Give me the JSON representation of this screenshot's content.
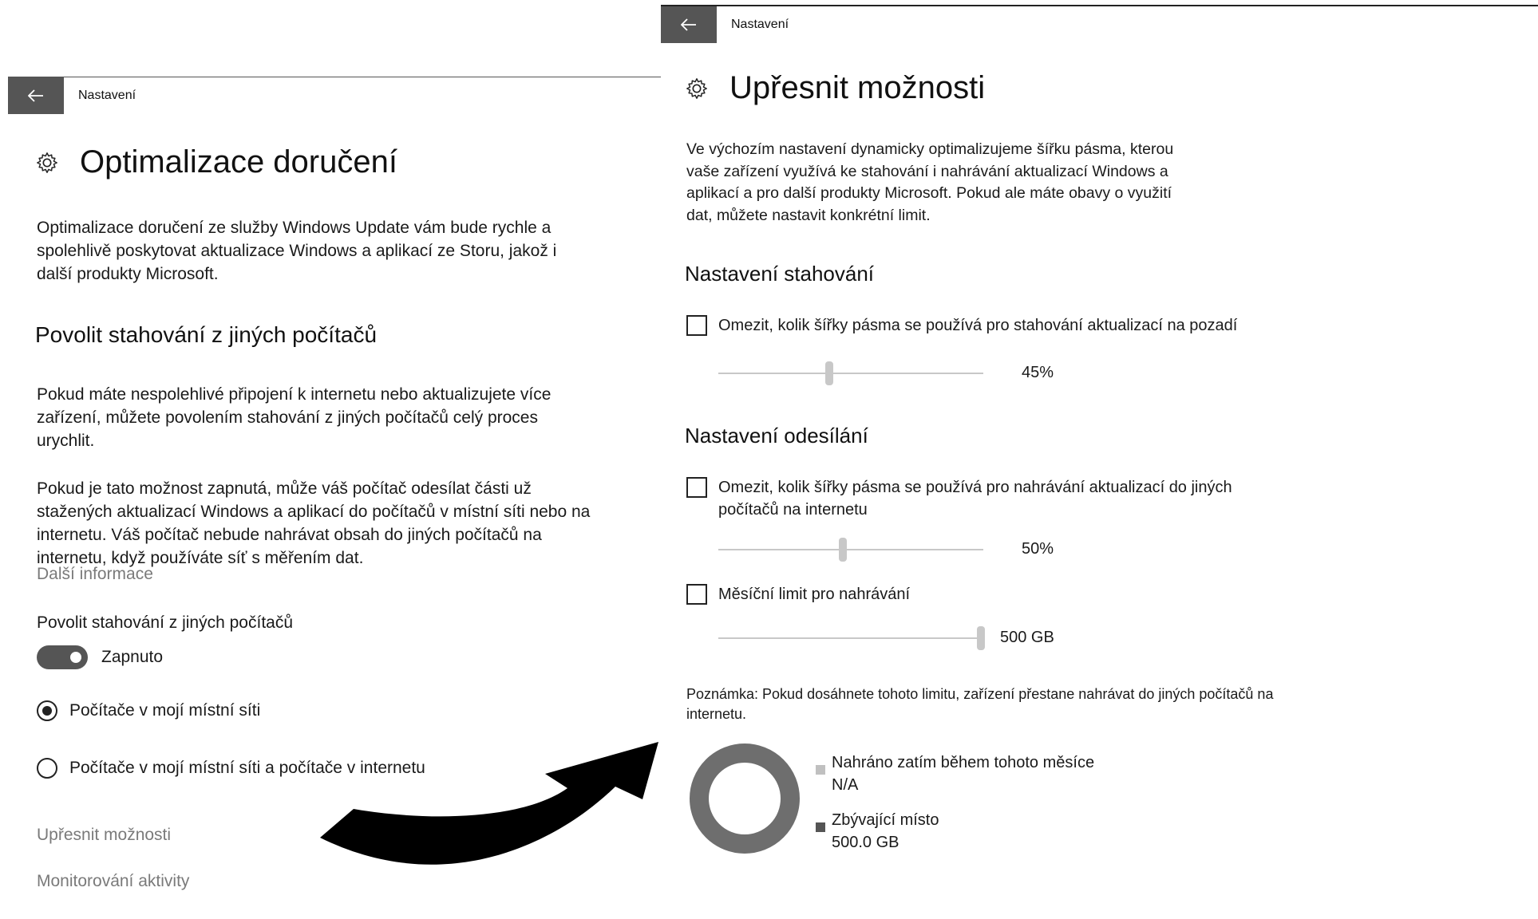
{
  "colors": {
    "title_bar_back": "#555555",
    "donut": "#6e6e6e",
    "legend_used": "#c0c0c0",
    "legend_free": "#555555",
    "arrow": "#000000"
  },
  "left": {
    "titlebar": {
      "back_icon": "back-arrow-icon",
      "title": "Nastavení"
    },
    "page_title": "Optimalizace doručení",
    "intro": "Optimalizace doručení ze služby Windows Update vám bude rychle a spolehlivě poskytovat aktualizace Windows a aplikací ze Storu, jakož i další produkty Microsoft.",
    "section_title": "Povolit stahování z jiných počítačů",
    "para1": "Pokud máte nespolehlivé připojení k internetu nebo aktualizujete více zařízení, můžete povolením stahování z jiných počítačů celý proces urychlit.",
    "para2": "Pokud je tato možnost zapnutá, může váš počítač odesílat části už stažených aktualizací Windows a aplikací do počítačů v místní síti nebo na internetu. Váš počítač nebude nahrávat obsah do jiných počítačů na internetu, když používáte síť s měřením dat.",
    "more_info": "Další informace",
    "toggle_label": "Povolit stahování z jiných počítačů",
    "toggle_state": "Zapnuto",
    "radio_local": "Počítače v mojí místní síti",
    "radio_internet": "Počítače v mojí místní síti a počítače v internetu",
    "link_advanced": "Upřesnit možnosti",
    "link_monitoring": "Monitorování aktivity"
  },
  "right": {
    "titlebar": {
      "back_icon": "back-arrow-icon",
      "title": "Nastavení"
    },
    "page_title": "Upřesnit možnosti",
    "intro": "Ve výchozím nastavení dynamicky optimalizujeme šířku pásma, kterou vaše zařízení využívá ke stahování i nahrávání aktualizací Windows a aplikací a pro další produkty Microsoft. Pokud ale máte obavy o využití dat, můžete nastavit konkrétní limit.",
    "download_title": "Nastavení stahování",
    "download_checkbox": "Omezit, kolik šířky pásma se používá pro stahování aktualizací na pozadí",
    "download_value": "45%",
    "download_level": 0.42,
    "upload_title": "Nastavení odesílání",
    "upload_checkbox": "Omezit, kolik šířky pásma se používá pro nahrávání aktualizací do jiných počítačů na internetu",
    "upload_value": "50%",
    "upload_level": 0.47,
    "monthly_checkbox": "Měsíční limit pro nahrávání",
    "monthly_value": "500 GB",
    "monthly_level": 0.99,
    "note": "Poznámka: Pokud dosáhnete tohoto limitu, zařízení přestane nahrávat do jiných počítačů na internetu.",
    "legend_used_label": "Nahráno zatím během tohoto měsíce",
    "legend_used_value": "N/A",
    "legend_free_label": "Zbývající místo",
    "legend_free_value": "500.0 GB"
  }
}
